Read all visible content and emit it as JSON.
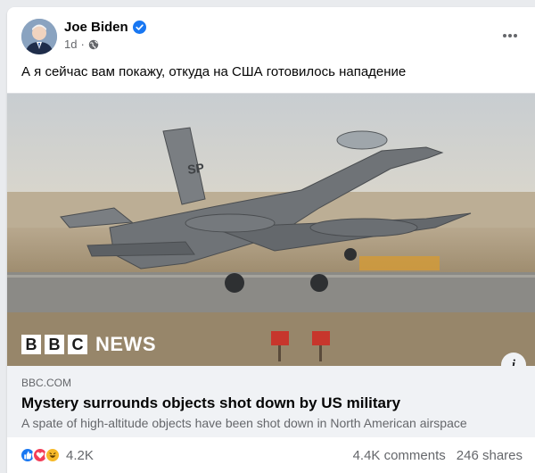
{
  "post": {
    "author": "Joe Biden",
    "time": "1d",
    "separator": "·",
    "text": "А я сейчас вам покажу, откуда на США готовилось нападение"
  },
  "link": {
    "domain": "BBC.COM",
    "title": "Mystery surrounds objects shot down by US military",
    "description": "A spate of high-altitude objects have been shot down in North American airspace",
    "watermark_letters": [
      "B",
      "B",
      "C"
    ],
    "watermark_word": "NEWS",
    "tail_code": "SP",
    "info_glyph": "i"
  },
  "engagement": {
    "reactions_count": "4.2K",
    "comments": "4.4K comments",
    "shares": "246 shares"
  },
  "icons": {
    "verified": "verified-badge-icon",
    "privacy": "globe-icon",
    "more": "more-options-icon",
    "like": "like-icon",
    "love": "love-icon",
    "haha": "haha-icon"
  },
  "colors": {
    "facebook_blue": "#1877f2",
    "love_red": "#f33e58",
    "haha_yellow": "#f7b928",
    "secondary_text": "#65676b",
    "link_meta_bg": "#f0f2f5"
  }
}
